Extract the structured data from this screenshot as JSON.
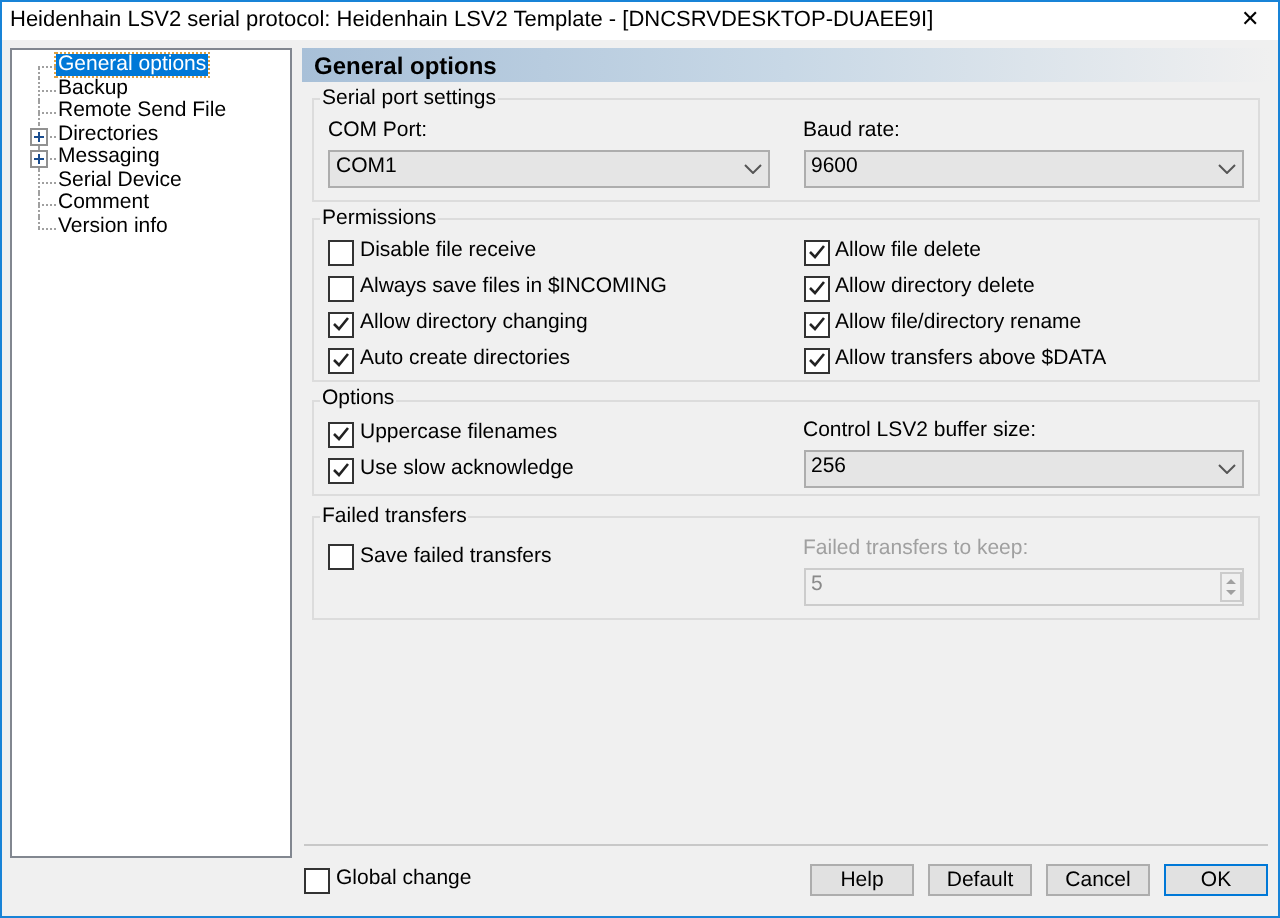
{
  "window": {
    "title": "Heidenhain LSV2 serial protocol: Heidenhain LSV2 Template - [DNCSRVDESKTOP-DUAEE9I]",
    "close": "✕"
  },
  "tree": [
    {
      "label": "General options",
      "kind": "leaf",
      "selected": true
    },
    {
      "label": "Backup",
      "kind": "leaf",
      "selected": false
    },
    {
      "label": "Remote Send File",
      "kind": "leaf",
      "selected": false
    },
    {
      "label": "Directories",
      "kind": "folder",
      "selected": false
    },
    {
      "label": "Messaging",
      "kind": "folder",
      "selected": false
    },
    {
      "label": "Serial Device",
      "kind": "leaf",
      "selected": false
    },
    {
      "label": "Comment",
      "kind": "leaf",
      "selected": false
    },
    {
      "label": "Version info",
      "kind": "leaf",
      "selected": false
    }
  ],
  "header": "General options",
  "serial_port": {
    "title": "Serial port settings",
    "fields": [
      {
        "label": "COM Port:",
        "value": "COM1"
      },
      {
        "label": "Baud rate:",
        "value": "9600"
      }
    ]
  },
  "permissions": {
    "title": "Permissions",
    "left": [
      {
        "label": "Disable file receive",
        "checked": false
      },
      {
        "label": "Always save files in $INCOMING",
        "checked": false
      },
      {
        "label": "Allow directory changing",
        "checked": true
      },
      {
        "label": "Auto create directories",
        "checked": true
      }
    ],
    "right": [
      {
        "label": "Allow file delete",
        "checked": true
      },
      {
        "label": "Allow directory delete",
        "checked": true
      },
      {
        "label": "Allow file/directory rename",
        "checked": true
      },
      {
        "label": "Allow transfers above $DATA",
        "checked": true
      }
    ]
  },
  "options": {
    "title": "Options",
    "checkboxes": [
      {
        "label": "Uppercase filenames",
        "checked": true
      },
      {
        "label": "Use slow acknowledge",
        "checked": true
      }
    ],
    "buffer": {
      "label": "Control LSV2 buffer size:",
      "value": "256"
    }
  },
  "failed_transfers": {
    "title": "Failed transfers",
    "checkbox": {
      "label": "Save failed transfers",
      "checked": false
    },
    "keep": {
      "label": "Failed transfers to keep:",
      "value": "5",
      "disabled": true
    }
  },
  "global_change": {
    "label": "Global change",
    "checked": false
  },
  "buttons": [
    {
      "label": "Help",
      "default": false
    },
    {
      "label": "Default",
      "default": false
    },
    {
      "label": "Cancel",
      "default": false
    },
    {
      "label": "OK",
      "default": true
    }
  ]
}
